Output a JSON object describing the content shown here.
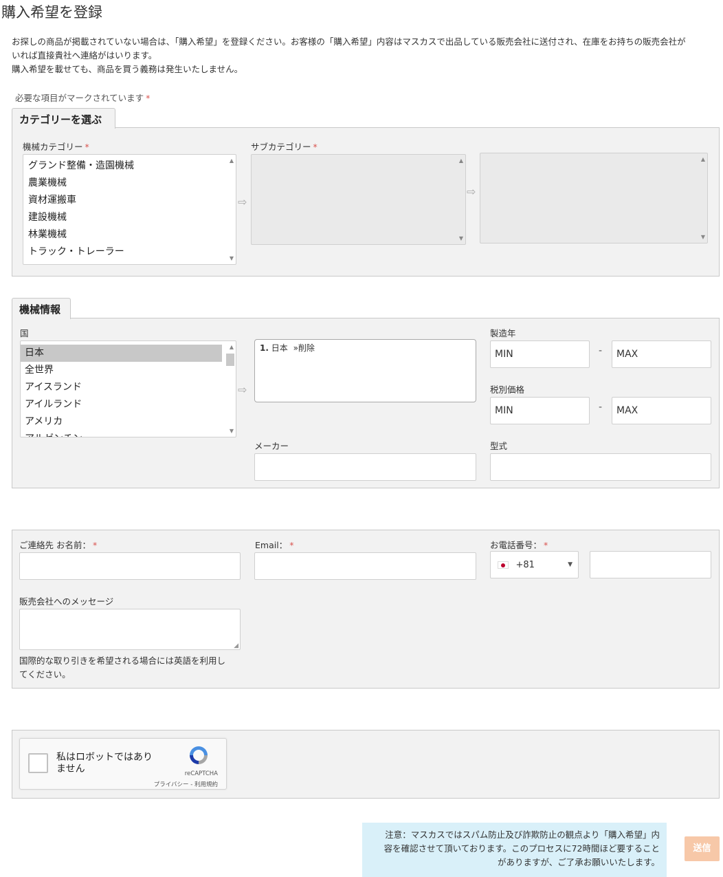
{
  "page": {
    "title": "購入希望を登録",
    "intro_line1": "お探しの商品が掲載されていない場合は、「購入希望」を登録ください。お客様の「購入希望」内容はマスカスで出品している販売会社に送付され、在庫をお持ちの販売会社が",
    "intro_line2": "いれば直接貴社へ連絡がはいります。",
    "intro_line3": "購入希望を載せても、商品を買う義務は発生いたしません。",
    "required_note": "必要な項目がマークされています",
    "required_mark": "*"
  },
  "category": {
    "tab_label": "カテゴリーを選ぶ",
    "machine_category_label": "機械カテゴリー",
    "subcategory_label": "サブカテゴリー",
    "items": [
      "グランド整備・造園機械",
      "農業機械",
      "資材運搬車",
      "建設機械",
      "林業機械",
      "トラック・トレーラー"
    ]
  },
  "machine_info": {
    "tab_label": "機械情報",
    "country_label": "国",
    "countries": [
      "日本",
      "全世界",
      "アイスランド",
      "アイルランド",
      "アメリカ",
      "アルゼンチン"
    ],
    "selected_index": "1.",
    "selected_country": "日本",
    "remove_link": "»削除",
    "year_label": "製造年",
    "price_label": "税別価格",
    "min_placeholder": "MIN",
    "max_placeholder": "MAX",
    "range_dash": "-",
    "maker_label": "メーカー",
    "model_label": "型式"
  },
  "contact": {
    "name_label": "ご連絡先 お名前：",
    "email_label": "Email：",
    "phone_label": "お電話番号：",
    "phone_code": "+81",
    "message_label": "販売会社へのメッセージ",
    "message_hint_line1": "国際的な取り引きを希望される場合には英語を利用し",
    "message_hint_line2": "てください。"
  },
  "captcha": {
    "label_line1": "私はロボットではあり",
    "label_line2": "ません",
    "brand": "reCAPTCHA",
    "links": "プライバシー - 利用規約"
  },
  "footer": {
    "notice_line1": "注意：マスカスではスパム防止及び詐欺防止の観点より「購入希望」内",
    "notice_line2": "容を確認させて頂いております。このプロセスに72時間ほど要すること",
    "notice_line3": "がありますが、ご了承お願いいたします。",
    "submit_label": "送信"
  },
  "colors": {
    "required": "#d9534f",
    "notice_bg": "#d9f0f9",
    "submit_bg": "#f7c8a8"
  }
}
